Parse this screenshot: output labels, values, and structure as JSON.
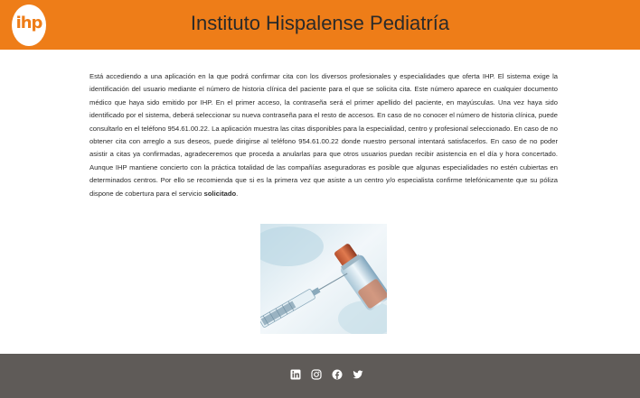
{
  "header": {
    "logo_text": "ihp",
    "title": "Instituto Hispalense Pediatría"
  },
  "content": {
    "paragraph": "Está accediendo a una aplicación en la que podrá confirmar cita con los diversos profesionales y especialidades que oferta IHP. El sistema exige la identificación del usuario mediante el número de historia clínica del paciente para el que se solicita cita. Este número aparece en cualquier documento médico que haya sido emitido por IHP. En el primer acceso, la contraseña será el primer apellido del paciente, en mayúsculas. Una vez haya sido identificado por el sistema, deberá seleccionar su nueva contraseña para el resto de accesos. En caso de no conocer el número de historia clínica, puede consultarlo en el teléfono 954.61.00.22. La aplicación muestra las citas disponibles para la especialidad, centro y profesional seleccionado. En caso de no obtener cita con arreglo a sus deseos, puede dirigirse al teléfono 954.61.00.22 donde nuestro personal intentará satisfacerlos. En caso de no poder asistir a citas ya confirmadas, agradeceremos que proceda a anularlas para que otros usuarios puedan recibir asistencia en el día y hora concertado. Aunque IHP mantiene concierto con la práctica totalidad de las compañías aseguradoras es posible que algunas especialidades no estén cubiertas en determinados centros. Por ello se recomienda que si es la primera vez que asiste a un centro y/o especialista confirme telefónicamente que su póliza dispone de cobertura para el servicio",
    "emphasis": "solicitado",
    "end": "."
  },
  "footer": {
    "icons": [
      "linkedin-icon",
      "instagram-icon",
      "facebook-icon",
      "twitter-icon"
    ]
  },
  "colors": {
    "header": "#ee7d18",
    "footer": "#5f5b58"
  }
}
